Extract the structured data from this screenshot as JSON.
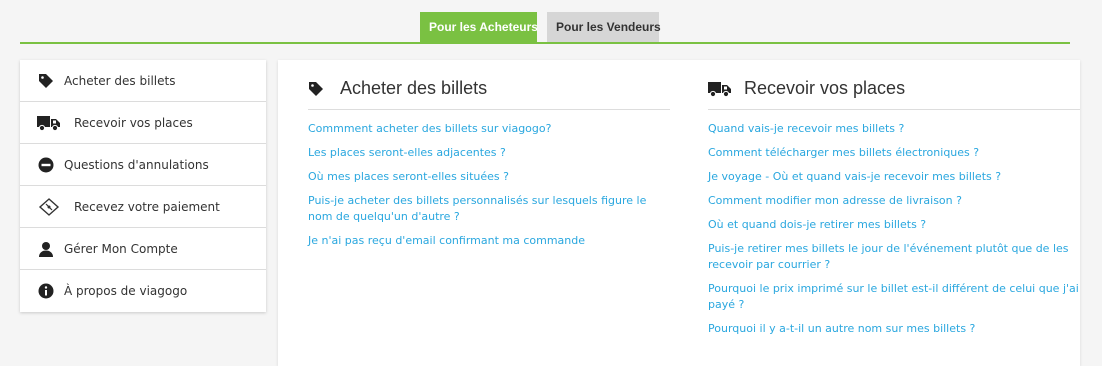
{
  "tabs": {
    "buyers": "Pour les Acheteurs",
    "sellers": "Pour les Vendeurs"
  },
  "colors": {
    "accent": "#7ac142",
    "link": "#2aa7df",
    "tab_inactive": "#d6d6d6"
  },
  "sidebar": {
    "items": [
      {
        "label": "Acheter des billets",
        "icon": "tag-icon"
      },
      {
        "label": "Recevoir vos places",
        "icon": "truck-icon"
      },
      {
        "label": "Questions d'annulations",
        "icon": "minus-circle-icon"
      },
      {
        "label": "Recevez votre paiement",
        "icon": "ticket-icon"
      },
      {
        "label": "Gérer Mon Compte",
        "icon": "user-icon"
      },
      {
        "label": "À propos de viagogo",
        "icon": "info-icon"
      }
    ]
  },
  "sections": {
    "buy": {
      "title": "Acheter des billets",
      "icon": "tag-icon",
      "links": [
        "Commment acheter des billets sur viagogo?",
        "Les places seront-elles adjacentes ?",
        "Où mes places seront-elles situées ?",
        "Puis-je acheter des billets personnalisés sur lesquels figure le nom de quelqu'un d'autre ?",
        "Je n'ai pas reçu d'email confirmant ma commande"
      ]
    },
    "receive": {
      "title": "Recevoir vos places",
      "icon": "truck-icon",
      "links": [
        "Quand vais-je recevoir mes billets ?",
        "Comment télécharger mes billets électroniques ?",
        "Je voyage - Où et quand vais-je recevoir mes billets ?",
        "Comment modifier mon adresse de livraison ?",
        "Où et quand dois-je retirer mes billets ?",
        "Puis-je retirer mes billets le jour de l'événement plutôt que de les recevoir par courrier ?",
        "Pourquoi le prix imprimé sur le billet est-il différent de celui que j'ai payé ?",
        "Pourquoi il y a-t-il un autre nom sur mes billets ?"
      ]
    }
  }
}
